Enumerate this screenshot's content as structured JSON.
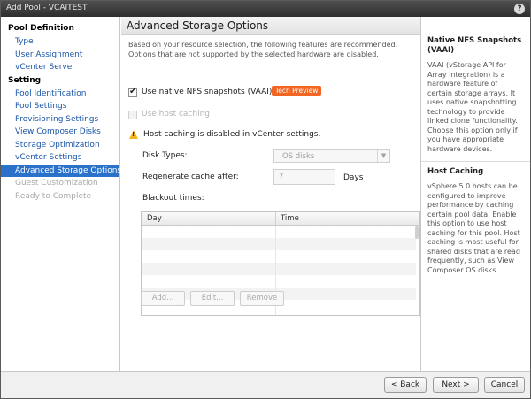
{
  "window": {
    "title": "Add Pool - VCAITEST",
    "help_label": "?"
  },
  "sidebar": {
    "sections": [
      {
        "heading": "Pool Definition",
        "items": [
          {
            "label": "Type",
            "state": "link"
          },
          {
            "label": "User Assignment",
            "state": "link"
          },
          {
            "label": "vCenter Server",
            "state": "link"
          }
        ]
      },
      {
        "heading": "Setting",
        "items": [
          {
            "label": "Pool Identification",
            "state": "link"
          },
          {
            "label": "Pool Settings",
            "state": "link"
          },
          {
            "label": "Provisioning Settings",
            "state": "link"
          },
          {
            "label": "View Composer Disks",
            "state": "link"
          },
          {
            "label": "Storage Optimization",
            "state": "link"
          },
          {
            "label": "vCenter Settings",
            "state": "link"
          },
          {
            "label": "Advanced Storage Options",
            "state": "active"
          },
          {
            "label": "Guest Customization",
            "state": "disabled"
          },
          {
            "label": "Ready to Complete",
            "state": "disabled"
          }
        ]
      }
    ]
  },
  "main": {
    "title": "Advanced Storage Options",
    "description": "Based on your resource selection, the following features are recommended. Options that are not supported by the selected hardware are disabled.",
    "vaai": {
      "label": "Use native NFS snapshots (VAAI)",
      "checked": true,
      "badge": "Tech Preview"
    },
    "host_caching": {
      "label": "Use host caching",
      "checked": false
    },
    "warning": "Host caching is disabled in vCenter settings.",
    "disk_types": {
      "label": "Disk Types:",
      "value": "OS disks"
    },
    "regenerate": {
      "label": "Regenerate cache after:",
      "value": "7",
      "unit": "Days"
    },
    "blackout": {
      "label": "Blackout times:",
      "columns": [
        "Day",
        "Time"
      ],
      "rows": []
    },
    "table_buttons": {
      "add": "Add...",
      "edit": "Edit...",
      "remove": "Remove"
    }
  },
  "help": {
    "sections": [
      {
        "heading": "Native NFS Snapshots (VAAI)",
        "text": "VAAI (vStorage API for Array Integration) is a hardware feature of certain storage arrays. It uses native snapshotting technology to provide linked clone functionality. Choose this option only if you have appropriate hardware devices."
      },
      {
        "heading": "Host Caching",
        "text": "vSphere 5.0 hosts can be configured to improve performance by caching certain pool data. Enable this option to use host caching for this pool. Host caching is most useful for shared disks that are read frequently, such as View Composer OS disks."
      }
    ]
  },
  "footer": {
    "back": "< Back",
    "next": "Next >",
    "cancel": "Cancel"
  },
  "colors": {
    "accent": "#2a71c9",
    "link": "#1a55a8",
    "badge": "#f26522",
    "warning": "#f3b71b"
  }
}
